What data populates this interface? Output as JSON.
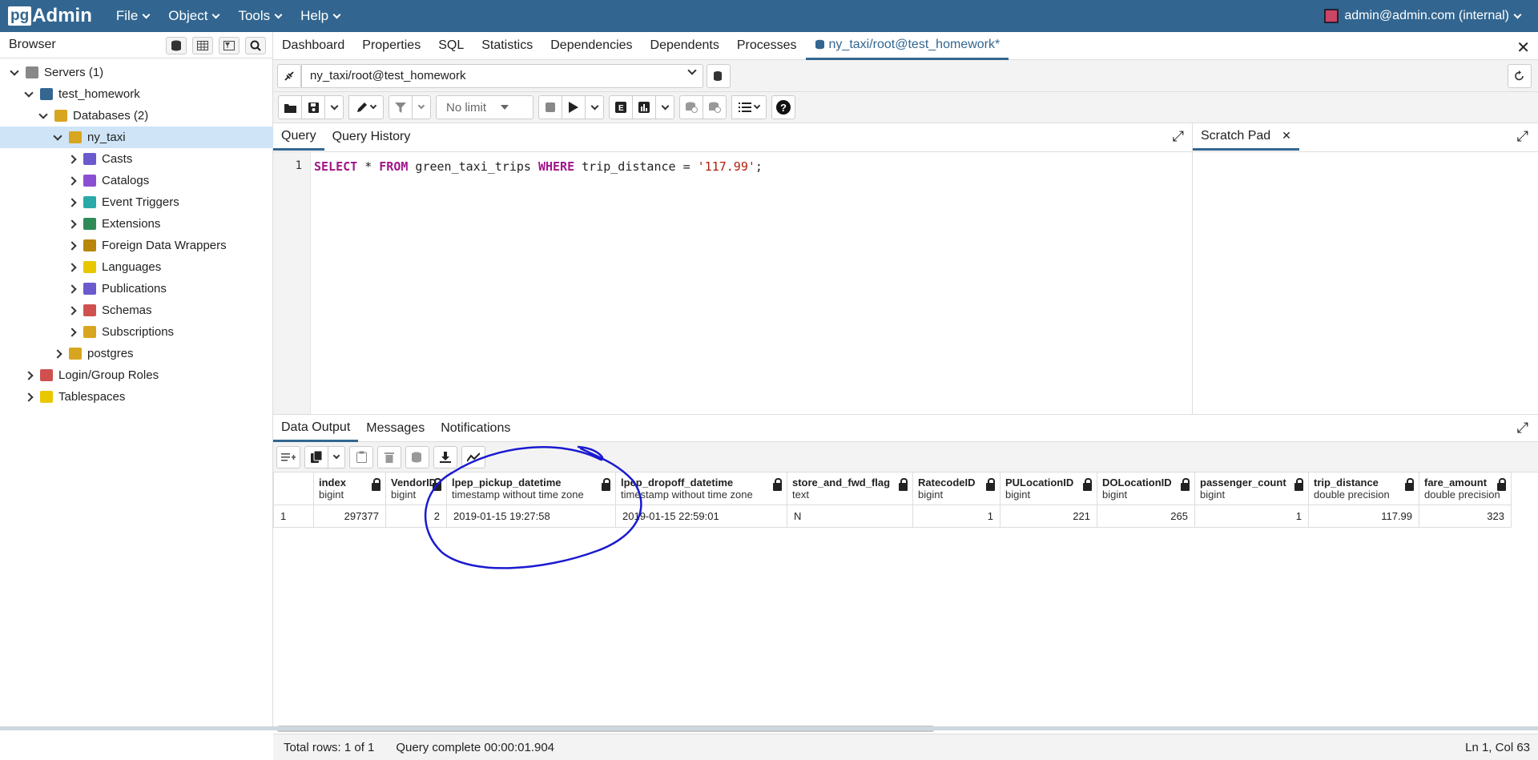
{
  "nav": {
    "logo_pg": "pg",
    "logo_text": "Admin",
    "menus": [
      "File",
      "Object",
      "Tools",
      "Help"
    ],
    "user": "admin@admin.com (internal)"
  },
  "browser": {
    "title": "Browser",
    "tree": [
      {
        "label": "Servers (1)",
        "level": 0,
        "expanded": true,
        "icon": "servers-icon"
      },
      {
        "label": "test_homework",
        "level": 1,
        "expanded": true,
        "icon": "server-icon"
      },
      {
        "label": "Databases (2)",
        "level": 2,
        "expanded": true,
        "icon": "databases-icon"
      },
      {
        "label": "ny_taxi",
        "level": 3,
        "expanded": true,
        "icon": "database-icon",
        "selected": true
      },
      {
        "label": "Casts",
        "level": 4,
        "icon": "casts-icon"
      },
      {
        "label": "Catalogs",
        "level": 4,
        "icon": "catalogs-icon"
      },
      {
        "label": "Event Triggers",
        "level": 4,
        "icon": "event-triggers-icon"
      },
      {
        "label": "Extensions",
        "level": 4,
        "icon": "extensions-icon"
      },
      {
        "label": "Foreign Data Wrappers",
        "level": 4,
        "icon": "fdw-icon"
      },
      {
        "label": "Languages",
        "level": 4,
        "icon": "languages-icon"
      },
      {
        "label": "Publications",
        "level": 4,
        "icon": "publications-icon"
      },
      {
        "label": "Schemas",
        "level": 4,
        "icon": "schemas-icon"
      },
      {
        "label": "Subscriptions",
        "level": 4,
        "icon": "subscriptions-icon"
      },
      {
        "label": "postgres",
        "level": 3,
        "icon": "database-icon"
      },
      {
        "label": "Login/Group Roles",
        "level": 1,
        "icon": "roles-icon"
      },
      {
        "label": "Tablespaces",
        "level": 1,
        "icon": "tablespaces-icon"
      }
    ]
  },
  "main_tabs": [
    "Dashboard",
    "Properties",
    "SQL",
    "Statistics",
    "Dependencies",
    "Dependents",
    "Processes",
    "ny_taxi/root@test_homework*"
  ],
  "connection": "ny_taxi/root@test_homework",
  "limit": "No limit",
  "editor_tabs": [
    "Query",
    "Query History"
  ],
  "scratch_pad": "Scratch Pad",
  "query": {
    "line_number": "1",
    "kw_select": "SELECT",
    "star": " * ",
    "kw_from": "FROM",
    "table": " green_taxi_trips ",
    "kw_where": "WHERE",
    "cond": " trip_distance = ",
    "value": "'117.99'",
    "end": ";"
  },
  "output_tabs": [
    "Data Output",
    "Messages",
    "Notifications"
  ],
  "grid": {
    "columns": [
      {
        "name": "index",
        "type": "bigint"
      },
      {
        "name": "VendorID",
        "type": "bigint"
      },
      {
        "name": "lpep_pickup_datetime",
        "type": "timestamp without time zone"
      },
      {
        "name": "lpep_dropoff_datetime",
        "type": "timestamp without time zone"
      },
      {
        "name": "store_and_fwd_flag",
        "type": "text"
      },
      {
        "name": "RatecodeID",
        "type": "bigint"
      },
      {
        "name": "PULocationID",
        "type": "bigint"
      },
      {
        "name": "DOLocationID",
        "type": "bigint"
      },
      {
        "name": "passenger_count",
        "type": "bigint"
      },
      {
        "name": "trip_distance",
        "type": "double precision"
      },
      {
        "name": "fare_amount",
        "type": "double precision"
      }
    ],
    "rows": [
      {
        "rownum": "1",
        "cells": [
          "297377",
          "2",
          "2019-01-15 19:27:58",
          "2019-01-15 22:59:01",
          "N",
          "1",
          "221",
          "265",
          "1",
          "117.99",
          "323"
        ]
      }
    ]
  },
  "status": {
    "rows": "Total rows: 1 of 1",
    "query": "Query complete 00:00:01.904",
    "position": "Ln 1, Col 63"
  },
  "colors": {
    "nav": "#326690",
    "accent": "#326690",
    "annotation": "#1a1ad0"
  }
}
